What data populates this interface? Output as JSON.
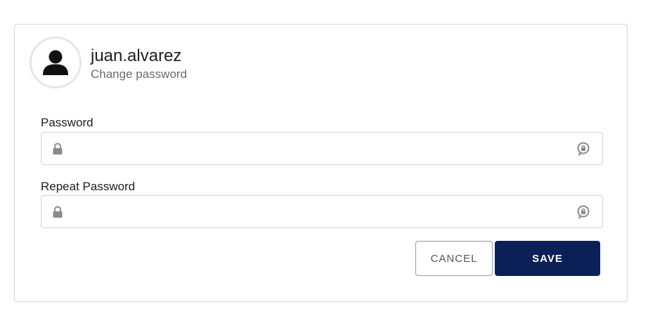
{
  "user": {
    "username": "juan.alvarez",
    "subtitle": "Change password",
    "avatar_icon": "user-silhouette-icon"
  },
  "form": {
    "password": {
      "label": "Password",
      "value": "",
      "leading_icon": "lock-icon",
      "trailing_icon": "reveal-password-icon"
    },
    "repeat_password": {
      "label": "Repeat Password",
      "value": "",
      "leading_icon": "lock-icon",
      "trailing_icon": "reveal-password-icon"
    }
  },
  "actions": {
    "cancel_label": "CANCEL",
    "save_label": "SAVE"
  },
  "colors": {
    "primary": "#0b2057",
    "border": "#d4d4d4",
    "icon_gray": "#8a8a8a"
  }
}
